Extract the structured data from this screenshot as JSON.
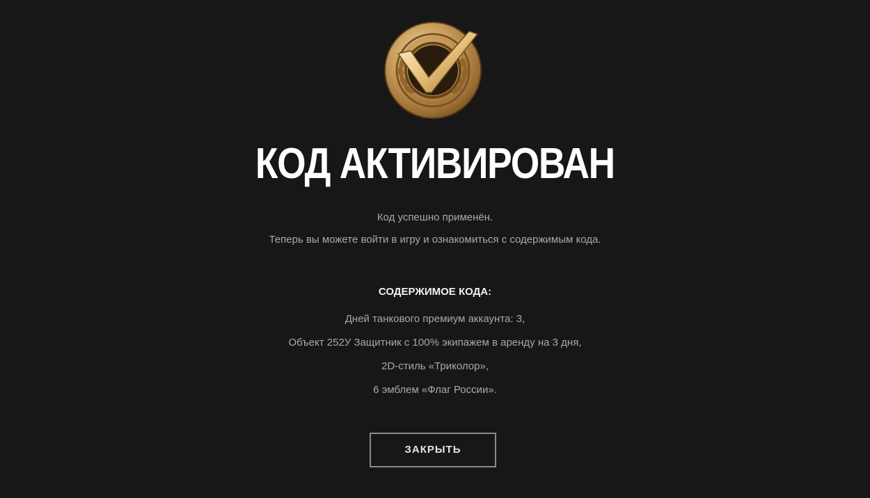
{
  "dialog": {
    "title": "КОД АКТИВИРОВАН",
    "description": [
      "Код успешно применён.",
      "Теперь вы можете войти в игру и ознакомиться с содержимым кода."
    ],
    "contents_heading": "СОДЕРЖИМОЕ КОДА:",
    "contents": [
      "Дней танкового премиум аккаунта: 3,",
      "Объект 252У Защитник с 100% экипажем в аренду на 3 дня,",
      "2D-стиль «Триколор»,",
      "6 эмблем «Флаг России»."
    ],
    "close_label": "ЗАКРЫТЬ"
  },
  "icons": {
    "medal": "gold-checkmark-medal-icon"
  },
  "colors": {
    "background": "#171717",
    "title": "#ffffff",
    "text": "#a9a9a9",
    "heading": "#f2f2f2",
    "button_border": "#8a8a8a",
    "medal_gold": "#c9a264"
  }
}
